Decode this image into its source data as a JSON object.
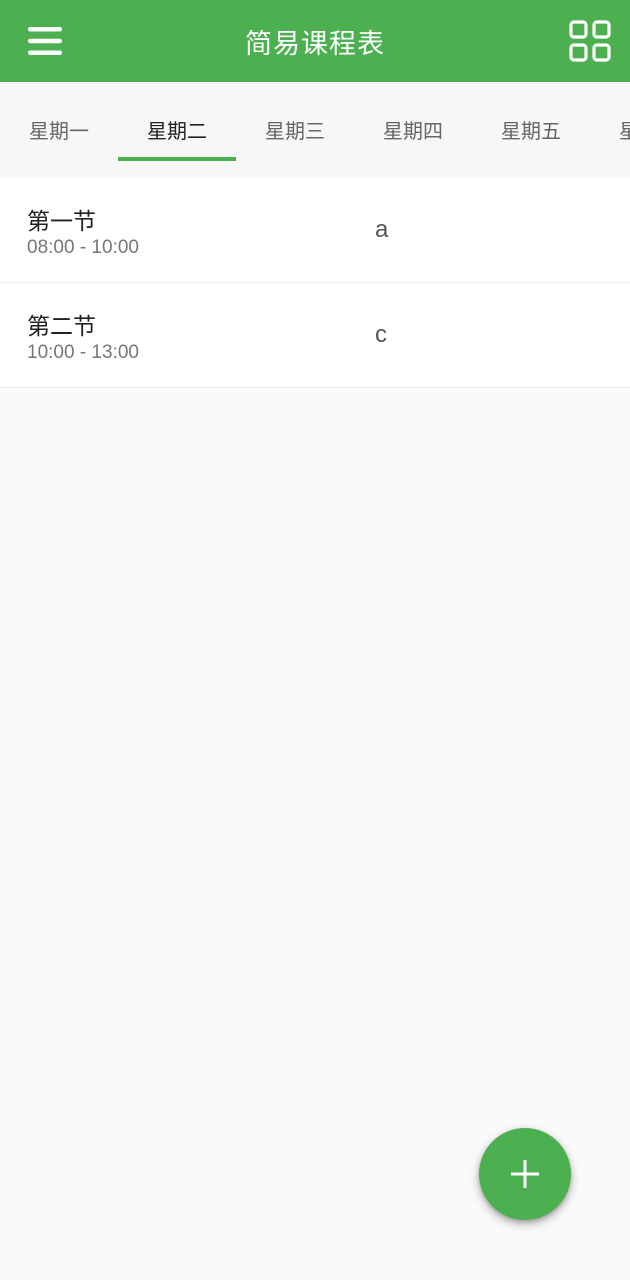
{
  "appbar": {
    "title": "简易课程表",
    "menu_icon": "hamburger-menu-icon",
    "view_icon": "grid-view-icon"
  },
  "tabs": [
    {
      "label": "星期一"
    },
    {
      "label": "星期二"
    },
    {
      "label": "星期三"
    },
    {
      "label": "星期四"
    },
    {
      "label": "星期五"
    },
    {
      "label": "星期六"
    }
  ],
  "active_tab": "星期二",
  "schedule": [
    {
      "name": "第一节",
      "time": "08:00 - 10:00",
      "course": "a"
    },
    {
      "name": "第二节",
      "time": "10:00 - 13:00",
      "course": "c"
    }
  ],
  "fab": {
    "icon": "plus-icon"
  },
  "colors": {
    "primary": "#4caf50",
    "background": "#fafafa"
  }
}
